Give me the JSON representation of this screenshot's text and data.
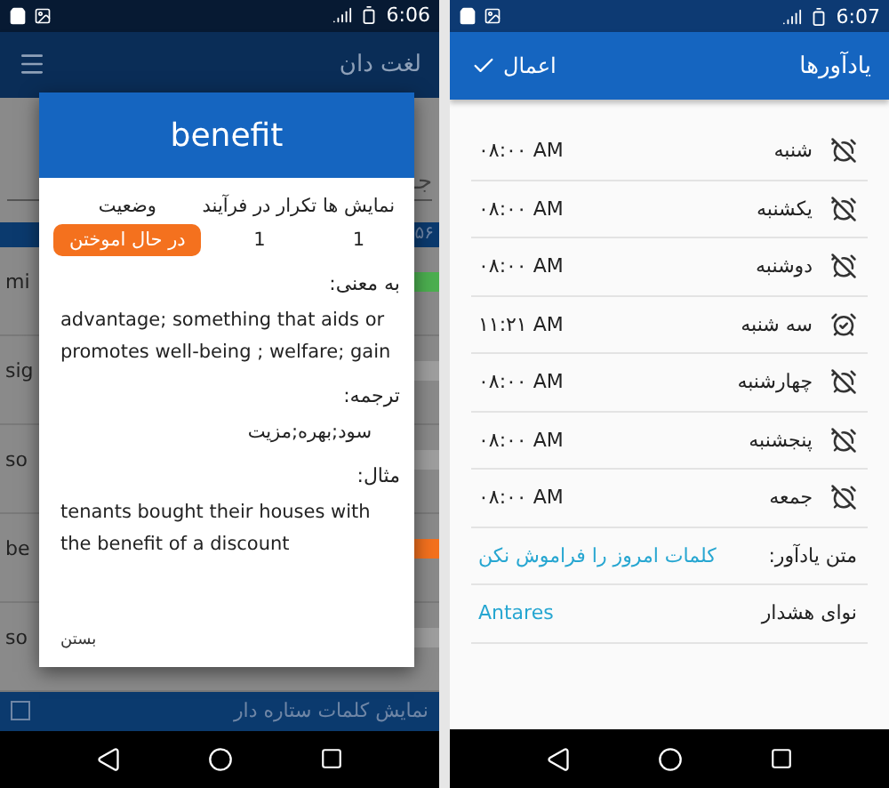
{
  "left_screen": {
    "status_bar": {
      "time": "6:06"
    },
    "app_bar": {
      "title": "لغت دان"
    },
    "search": {
      "placeholder": "جـ"
    },
    "count_bar": {
      "count": "۵۶"
    },
    "word_rows": [
      {
        "word": "mi",
        "color": "#4caf50"
      },
      {
        "word": "sig",
        "color": "#9e9e9e"
      },
      {
        "word": "so",
        "color": "#9e9e9e"
      },
      {
        "word": "be",
        "color": "#f4711e"
      },
      {
        "word": "so",
        "color": "#9e9e9e"
      }
    ],
    "footer": {
      "label": "نمایش کلمات ستاره دار",
      "checked": false
    },
    "dialog": {
      "title": "benefit",
      "stats": [
        {
          "label": "نمایش ها",
          "value": "1",
          "kind": "plain"
        },
        {
          "label": "تکرار در فرآیند",
          "value": "1",
          "kind": "plain"
        },
        {
          "label": "وضعیت",
          "value": "در حال اموختن",
          "kind": "badge"
        }
      ],
      "sections": [
        {
          "label": "به معنی:",
          "text": "advantage; something that aids or promotes well-being ; welfare; gain",
          "kind": "english"
        },
        {
          "label": "ترجمه:",
          "text": "سود;بهره;مزیت",
          "kind": "persian"
        },
        {
          "label": "مثال:",
          "text": "tenants bought their houses with the benefit of a discount",
          "kind": "english"
        }
      ],
      "close": "بستن"
    }
  },
  "right_screen": {
    "status_bar": {
      "time": "6:07"
    },
    "app_bar": {
      "title": "یادآورها",
      "action": "اعمال"
    },
    "days": [
      {
        "day": "شنبه",
        "time": "۰۸:۰۰ AM",
        "enabled": false
      },
      {
        "day": "یکشنبه",
        "time": "۰۸:۰۰ AM",
        "enabled": false
      },
      {
        "day": "دوشنبه",
        "time": "۰۸:۰۰ AM",
        "enabled": false
      },
      {
        "day": "سه شنبه",
        "time": "۱۱:۲۱ AM",
        "enabled": true
      },
      {
        "day": "چهارشنبه",
        "time": "۰۸:۰۰ AM",
        "enabled": false
      },
      {
        "day": "پنجشنبه",
        "time": "۰۸:۰۰ AM",
        "enabled": false
      },
      {
        "day": "جمعه",
        "time": "۰۸:۰۰ AM",
        "enabled": false
      }
    ],
    "settings": [
      {
        "label": "متن یادآور:",
        "value": "کلمات امروز را فراموش نکن"
      },
      {
        "label": "نوای هشدار",
        "value": "Antares"
      }
    ]
  }
}
